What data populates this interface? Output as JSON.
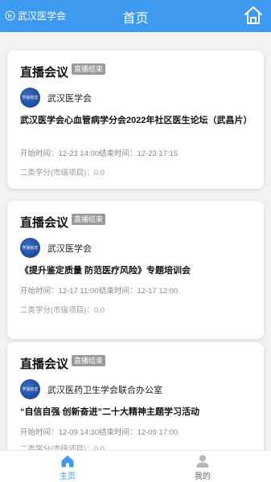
{
  "header": {
    "brand": "武汉医学会",
    "title": "首页",
    "brand_icon": "org-emblem-icon",
    "home_icon": "home-icon"
  },
  "cards": [
    {
      "type": "直播会议",
      "status": "直播结束",
      "org_logo_text": "学会标志",
      "org": "武汉医学会",
      "topic": "武汉医学会心血管病学分会2022年社区医生论坛（武昌片）",
      "start": "开始时间：12-23 14:00",
      "end": "结束时间：12-23 17:15",
      "credit": "二类学分(市级项目)：0.0"
    },
    {
      "type": "直播会议",
      "status": "直播结束",
      "org_logo_text": "学会标志",
      "org": "武汉医学会",
      "topic": "《提升鉴定质量 防范医疗风险》专题培训会",
      "start": "开始时间：12-17 11:00",
      "end": "结束时间：12-17 12:00",
      "credit": "二类学分(市级项目)：0.0"
    },
    {
      "type": "直播会议",
      "status": "直播结束",
      "org_logo_text": "学会标志",
      "org": "武汉医药卫生学会联合办公室",
      "topic": "“自信自强 创新奋进”二十大精神主题学习活动",
      "start": "开始时间：12-09 14:30",
      "end": "结束时间：12-09 17:00",
      "credit": "二类学分(市级项目)：0.0"
    }
  ],
  "tabbar": {
    "home_label": "主页",
    "mine_label": "我的",
    "active_color": "#3d9aee"
  },
  "colors": {
    "header_bg": "#3d9aee",
    "badge_bg": "#999999",
    "page_bg": "#f2f2f2"
  }
}
